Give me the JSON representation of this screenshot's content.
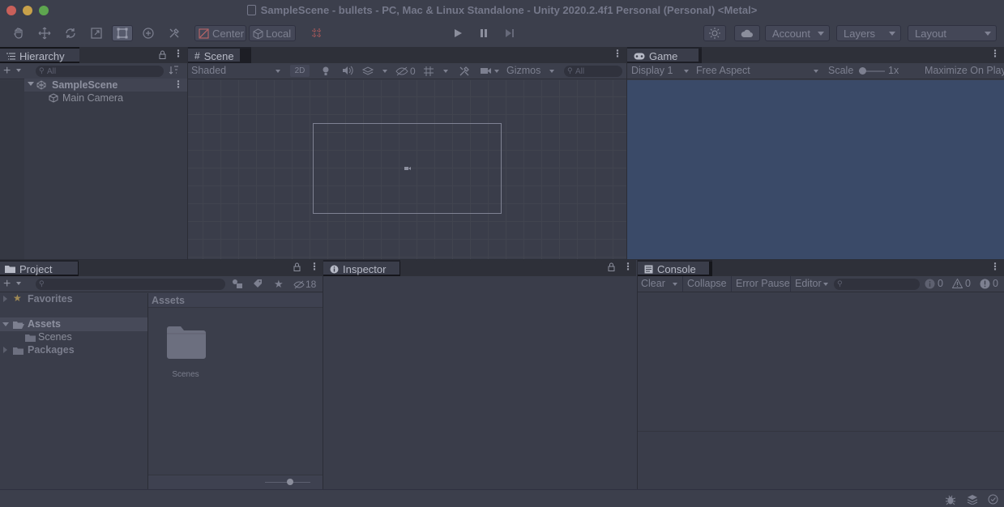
{
  "window": {
    "title": "SampleScene - bullets - PC, Mac & Linux Standalone - Unity 2020.2.4f1 Personal (Personal) <Metal>",
    "traffic_colors": [
      "#c9605a",
      "#c8a14a",
      "#5ea64f"
    ]
  },
  "toolbar": {
    "tools": [
      "hand-tool-icon",
      "move-tool-icon",
      "rotate-tool-icon",
      "scale-tool-icon",
      "rect-tool-icon",
      "transform-tool-icon",
      "custom-tool-icon"
    ],
    "pivot_mode": "Center",
    "pivot_space": "Local",
    "account": "Account",
    "layers": "Layers",
    "layout": "Layout"
  },
  "hierarchy": {
    "tab": "Hierarchy",
    "search_placeholder": "All",
    "scene": "SampleScene",
    "items": [
      "Main Camera"
    ]
  },
  "scene": {
    "tab": "Scene",
    "draw_mode": "Shaded",
    "mode_2d": "2D",
    "hidden_count": "0",
    "gizmos": "Gizmos",
    "search_placeholder": "All"
  },
  "game": {
    "tab": "Game",
    "display": "Display 1",
    "aspect": "Free Aspect",
    "scale_label": "Scale",
    "scale_value": "1x",
    "maximize": "Maximize On Play",
    "background_color": "#3a4a68"
  },
  "project": {
    "tab": "Project",
    "hidden_packages": "18",
    "tree": {
      "favorites": "Favorites",
      "assets": "Assets",
      "scenes": "Scenes",
      "packages": "Packages"
    },
    "breadcrumb": "Assets",
    "grid_items": [
      "Scenes"
    ]
  },
  "inspector": {
    "tab": "Inspector"
  },
  "console": {
    "tab": "Console",
    "clear": "Clear",
    "collapse": "Collapse",
    "error_pause": "Error Pause",
    "editor": "Editor",
    "info_count": "0",
    "warn_count": "0",
    "error_count": "0"
  }
}
